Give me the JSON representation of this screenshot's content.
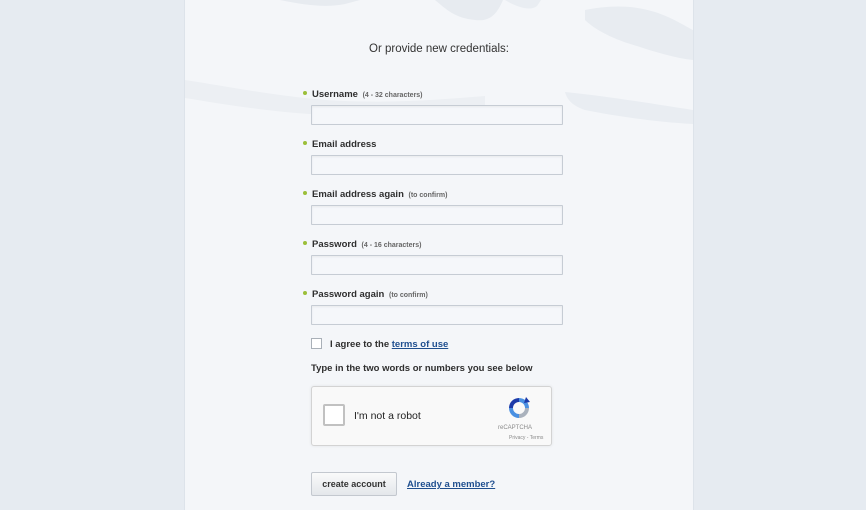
{
  "form": {
    "heading": "Or provide new credentials:",
    "fields": [
      {
        "label": "Username",
        "hint": "(4 - 32 characters)",
        "value": "",
        "placeholder": ""
      },
      {
        "label": "Email address",
        "hint": "",
        "value": "",
        "placeholder": ""
      },
      {
        "label": "Email address again",
        "hint": "(to confirm)",
        "value": "",
        "placeholder": ""
      },
      {
        "label": "Password",
        "hint": "(4 - 16 characters)",
        "value": "",
        "placeholder": ""
      },
      {
        "label": "Password again",
        "hint": "(to confirm)",
        "value": "",
        "placeholder": ""
      }
    ],
    "agree_prefix": "I agree to the",
    "terms_link": "terms of use",
    "terms_checked": false,
    "captcha_instruction": "Type in the two words or numbers you see below",
    "recaptcha": {
      "label": "I'm not a robot",
      "brand": "reCAPTCHA",
      "links": "Privacy - Terms",
      "icon": "recaptcha-logo-icon"
    },
    "submit_label": "create account",
    "member_link": "Already a member?"
  },
  "colors": {
    "background": "#e6ebf1",
    "panel": "#f4f6f9",
    "required_dot": "#9bbf3a",
    "link": "#1f4f8f"
  }
}
